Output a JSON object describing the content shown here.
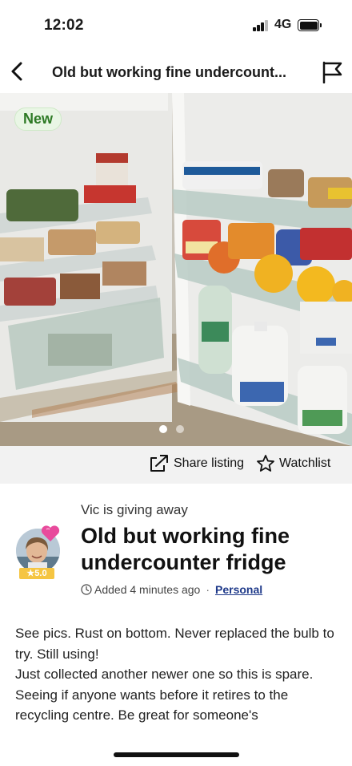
{
  "status_bar": {
    "time": "12:02",
    "network": "4G"
  },
  "header": {
    "title": "Old but working fine undercount..."
  },
  "photo": {
    "badge": "New",
    "dot_count": 2,
    "active_dot": 0
  },
  "actions": {
    "share_label": "Share listing",
    "watchlist_label": "Watchlist"
  },
  "listing": {
    "giver_text": "Vic is giving away",
    "title": "Old but working fine undercounter fridge",
    "rating": "★5.0",
    "added": "Added 4 minutes ago",
    "separator": "·",
    "type": "Personal",
    "description": "See pics. Rust on bottom. Never replaced the bulb to try. Still using!\nJust collected another newer one so this is spare. Seeing if anyone wants before it retires to the recycling centre. Be great for someone's"
  },
  "colors": {
    "accent_blue": "#1f3a8a",
    "badge_green": "#2d7a25",
    "rating_gold": "#f5c542"
  }
}
